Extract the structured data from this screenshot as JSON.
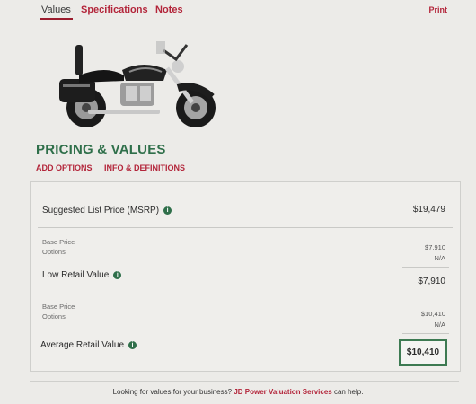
{
  "tabs": {
    "values": "Values",
    "specifications": "Specifications",
    "notes": "Notes"
  },
  "print_label": "Print",
  "pricing": {
    "title": "PRICING & VALUES",
    "add_options": "ADD OPTIONS",
    "info_definitions": "INFO & DEFINITIONS"
  },
  "msrp": {
    "label": "Suggested List Price (MSRP)",
    "value": "$19,479"
  },
  "low_retail": {
    "base_price_label": "Base Price",
    "base_price_value": "$7,910",
    "options_label": "Options",
    "options_value": "N/A",
    "label": "Low Retail Value",
    "value": "$7,910"
  },
  "average_retail": {
    "base_price_label": "Base Price",
    "base_price_value": "$10,410",
    "options_label": "Options",
    "options_value": "N/A",
    "label": "Average Retail Value",
    "value": "$10,410"
  },
  "footer": {
    "prefix": "Looking for values for your business?",
    "link": "JD Power Valuation Services",
    "suffix": "can help."
  },
  "colors": {
    "accent_red": "#b3253a",
    "accent_green": "#2f6f4a"
  }
}
